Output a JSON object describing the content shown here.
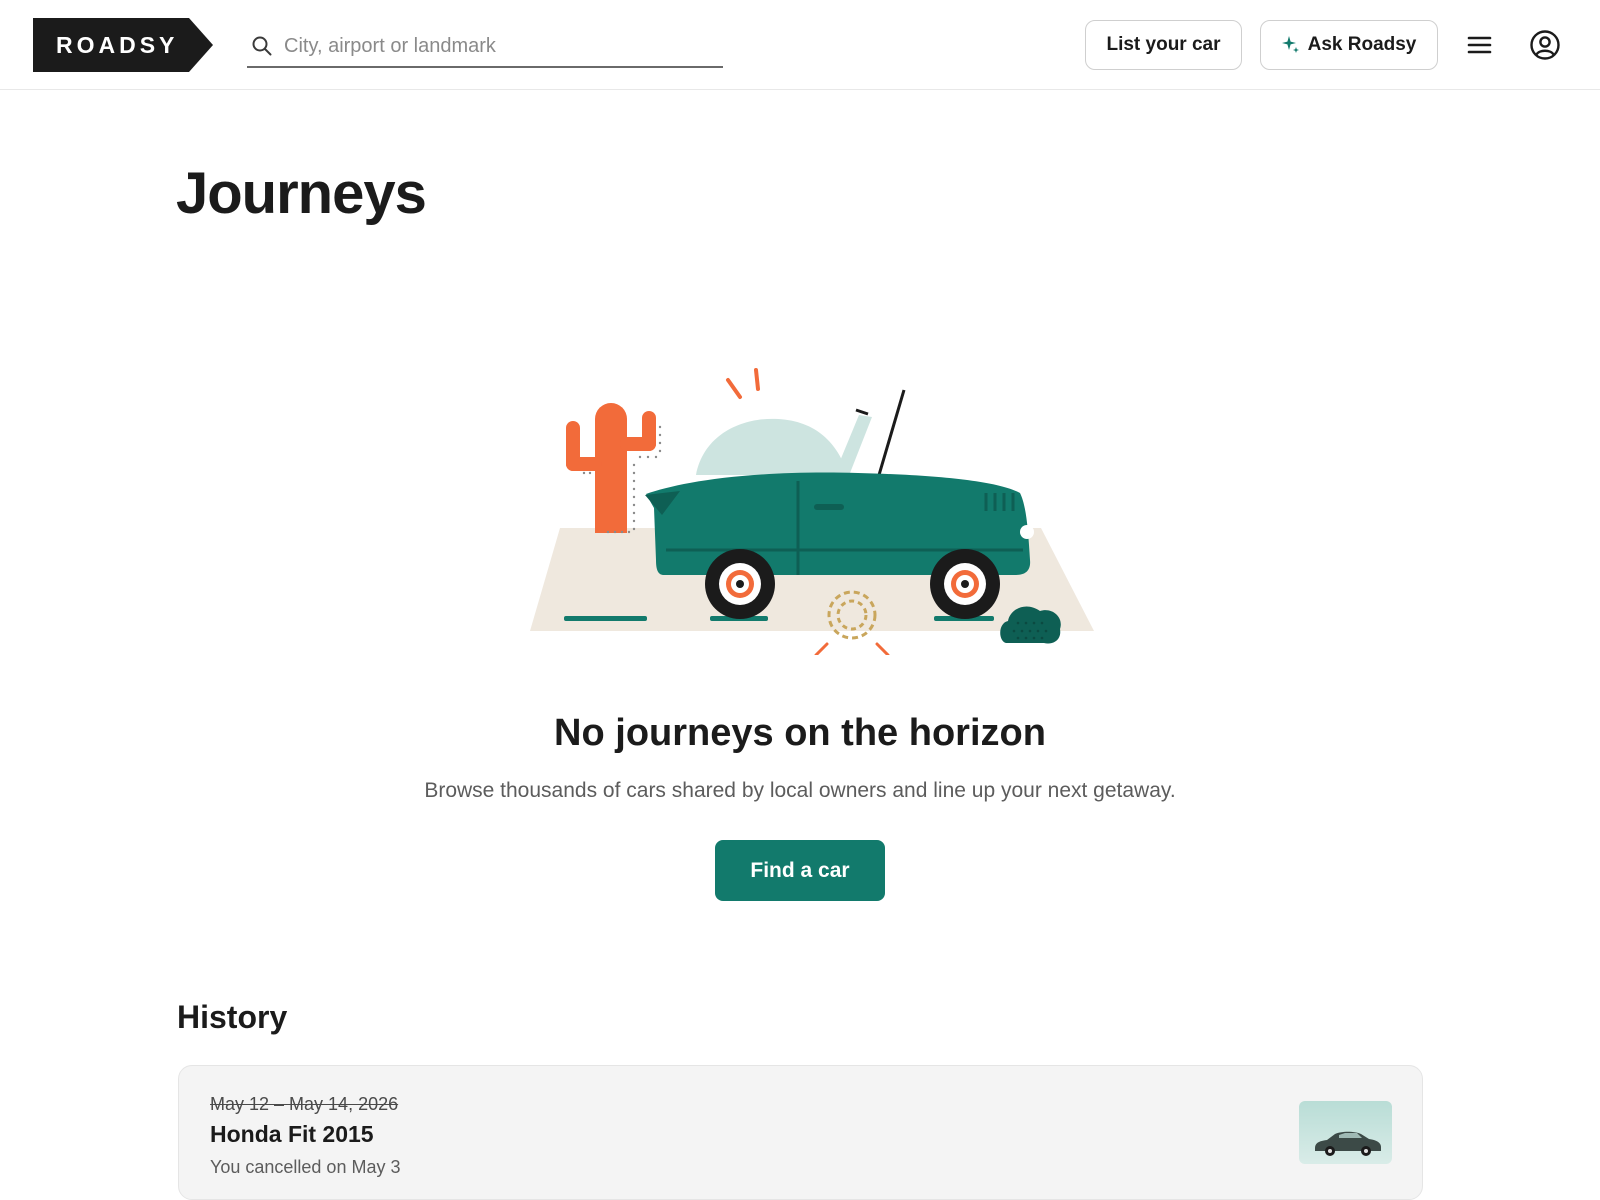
{
  "header": {
    "logo_text": "ROADSY",
    "search_placeholder": "City, airport or landmark",
    "list_car_label": "List your car",
    "ask_label": "Ask Roadsy",
    "icons": {
      "search": "search-icon",
      "sparkle": "sparkle-icon",
      "menu": "hamburger-menu-icon",
      "account": "user-account-icon"
    }
  },
  "main": {
    "title": "Journeys",
    "empty_state": {
      "title": "No journeys on the horizon",
      "subtitle": "Browse thousands of cars shared by local owners and line up your next getaway.",
      "cta_label": "Find a car"
    }
  },
  "history": {
    "title": "History",
    "trips": [
      {
        "dates": "May 12 – May 14, 2026",
        "car": "Honda Fit 2015",
        "status": "You cancelled on May 3"
      }
    ]
  },
  "colors": {
    "brand_dark": "#1b1b1b",
    "accent_teal": "#127a6c",
    "cactus_orange": "#f26b3a",
    "sand": "#efe8de"
  }
}
